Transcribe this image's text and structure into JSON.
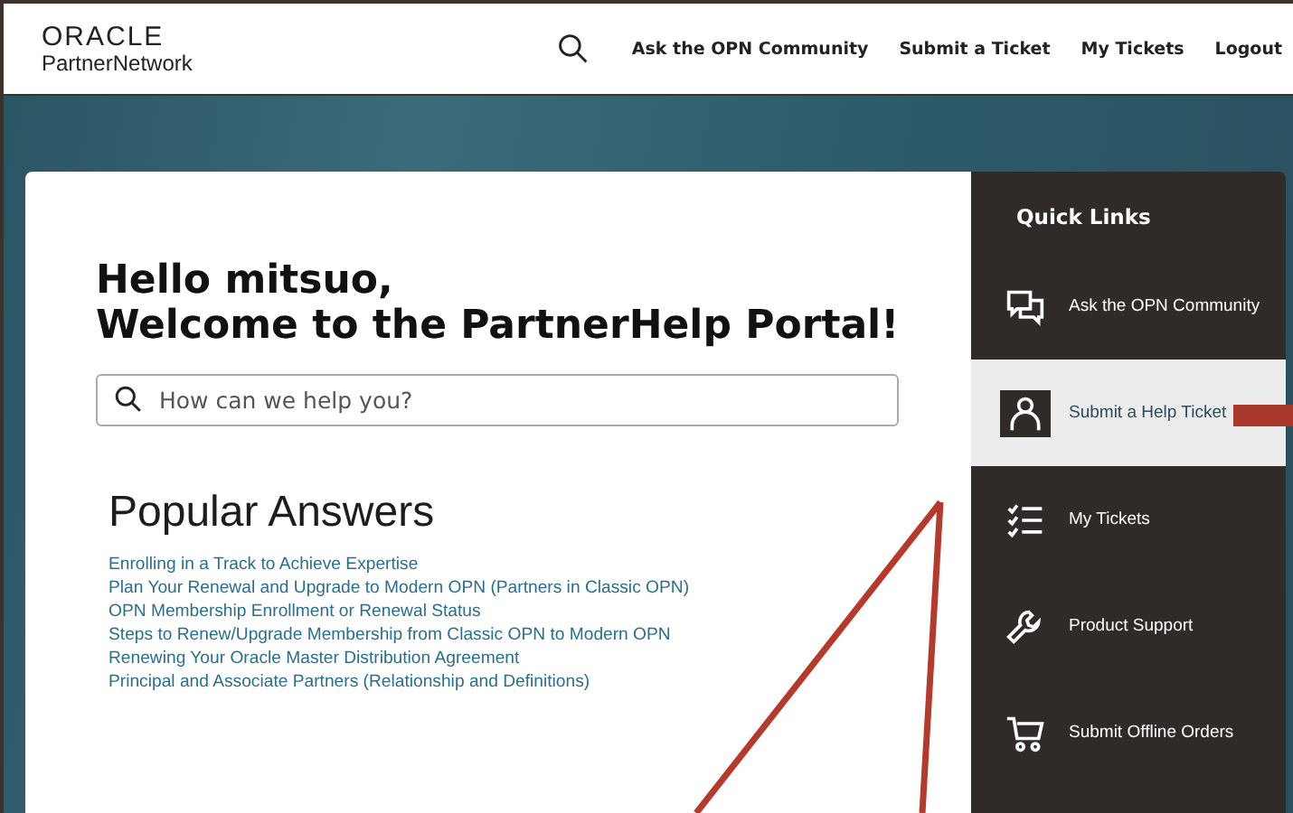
{
  "header": {
    "logo": {
      "wordmark": "ORACLE",
      "subtitle": "PartnerNetwork"
    },
    "nav": [
      "Ask the OPN Community",
      "Submit a Ticket",
      "My Tickets",
      "Logout"
    ]
  },
  "welcome": {
    "greeting": "Hello mitsuo,",
    "title": "Welcome to the PartnerHelp Portal!"
  },
  "search": {
    "placeholder": "How can we help you?"
  },
  "popular_answers": {
    "heading": "Popular Answers",
    "links": [
      "Enrolling in a Track to Achieve Expertise",
      "Plan Your Renewal and Upgrade to Modern OPN (Partners in Classic OPN)",
      "OPN Membership Enrollment or Renewal Status",
      "Steps to Renew/Upgrade Membership from Classic OPN to Modern OPN",
      "Renewing Your Oracle Master Distribution Agreement",
      "Principal and Associate Partners (Relationship and Definitions)"
    ]
  },
  "quick_links": {
    "title": "Quick Links",
    "items": [
      {
        "label": "Ask the OPN Community",
        "kind": "community",
        "selected": false
      },
      {
        "label": "Submit a Help Ticket",
        "kind": "person",
        "selected": true
      },
      {
        "label": "My Tickets",
        "kind": "checklist",
        "selected": false
      },
      {
        "label": "Product Support",
        "kind": "wrench",
        "selected": false
      },
      {
        "label": "Submit Offline Orders",
        "kind": "cart",
        "selected": false
      }
    ]
  }
}
